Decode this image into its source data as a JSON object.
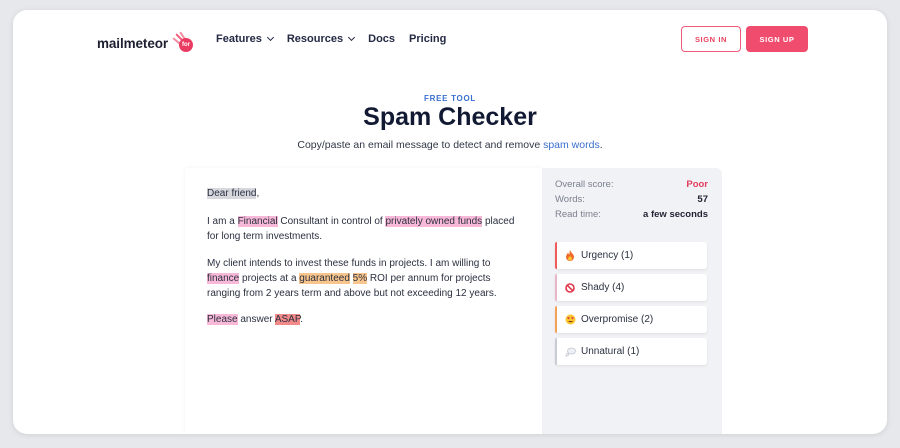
{
  "brand": {
    "name": "mailmeteor",
    "badge": "for"
  },
  "nav": {
    "items": [
      {
        "label": "Features",
        "has_dropdown": true
      },
      {
        "label": "Resources",
        "has_dropdown": true
      },
      {
        "label": "Docs",
        "has_dropdown": false
      },
      {
        "label": "Pricing",
        "has_dropdown": false
      }
    ],
    "sign_in": "SIGN IN",
    "sign_up": "SIGN UP"
  },
  "hero": {
    "eyebrow": "FREE TOOL",
    "title": "Spam Checker",
    "subtitle_pre": "Copy/paste an email message to detect and remove ",
    "subtitle_link": "spam words",
    "subtitle_post": "."
  },
  "editor": {
    "p1": {
      "s1": "Dear friend",
      "s2": ","
    },
    "p2": {
      "s1": "I am a ",
      "s2": "Financial",
      "s3": " Consultant in control of ",
      "s4": "privately owned funds",
      "s5": " placed for long term investments."
    },
    "p3": {
      "s1": "My client intends to invest these funds in projects. I am willing to ",
      "s2": "finance",
      "s3": " projects at a ",
      "s4": "guaranteed",
      "s5": " ",
      "s6": "5%",
      "s7": " ROI per annum for projects ranging from 2 years term and above but not exceeding 12 years."
    },
    "p4": {
      "s1": "Please",
      "s2": " answer ",
      "s3": "ASAP",
      "s4": "."
    }
  },
  "results": {
    "score_label": "Overall score:",
    "score_value": "Poor",
    "words_label": "Words:",
    "words_value": "57",
    "time_label": "Read time:",
    "time_value": "a few seconds",
    "categories": [
      {
        "label": "Urgency (1)",
        "icon": "fire-icon",
        "color": "#ef5a5a"
      },
      {
        "label": "Shady (4)",
        "icon": "prohibited-icon",
        "color": "#e8b7c7"
      },
      {
        "label": "Overpromise (2)",
        "icon": "heart-eyes-icon",
        "color": "#f4a259"
      },
      {
        "label": "Unnatural (1)",
        "icon": "thought-bubble-icon",
        "color": "#c9ccd4"
      }
    ]
  },
  "colors": {
    "accent": "#f04d6e",
    "link": "#3a6fd0",
    "poor": "#e23d5e"
  }
}
